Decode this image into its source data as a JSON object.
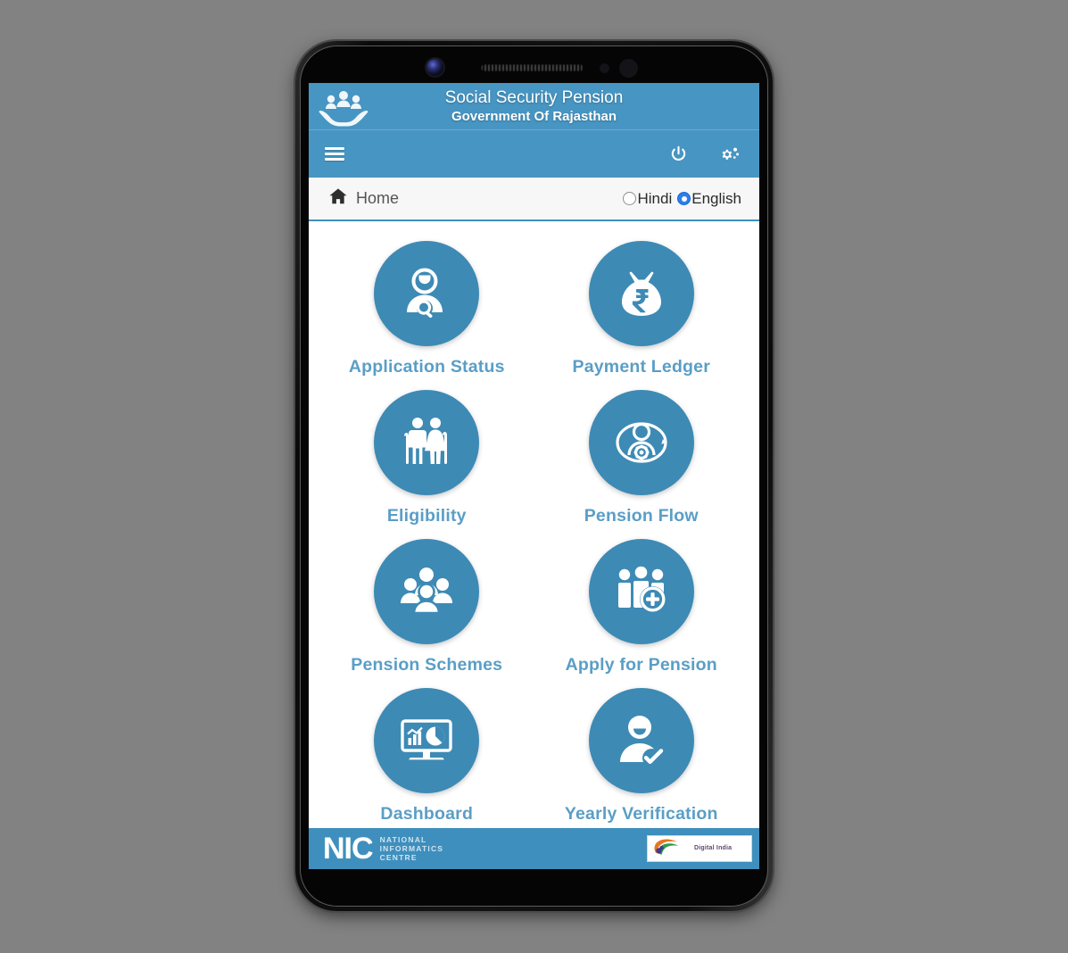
{
  "app": {
    "title": "Social Security Pension",
    "subtitle": "Government Of Rajasthan",
    "logo_icon": "hands-holding-family-logo",
    "accent_color": "#4795c2",
    "tile_circle_color": "#3d8ab5",
    "tile_label_color": "#5a9ec6",
    "footer_color": "#3e8fbd"
  },
  "navbar": {
    "menu_icon": "hamburger-menu-icon",
    "power_icon": "power-icon",
    "settings_icon": "cogs-icon"
  },
  "breadcrumb": {
    "home_icon": "home-icon",
    "home_label": "Home"
  },
  "language": {
    "options": [
      {
        "label": "Hindi",
        "selected": false
      },
      {
        "label": "English",
        "selected": true
      }
    ]
  },
  "tiles": [
    {
      "label": "Application Status",
      "icon": "user-search-icon"
    },
    {
      "label": "Payment Ledger",
      "icon": "money-bag-rupee-icon"
    },
    {
      "label": "Eligibility",
      "icon": "elderly-couple-icon"
    },
    {
      "label": "Pension Flow",
      "icon": "user-gear-cycle-icon"
    },
    {
      "label": "Pension Schemes",
      "icon": "people-group-icon"
    },
    {
      "label": "Apply for Pension",
      "icon": "people-add-icon"
    },
    {
      "label": "Dashboard",
      "icon": "monitor-charts-icon"
    },
    {
      "label": "Yearly Verification",
      "icon": "user-check-icon"
    }
  ],
  "footer": {
    "nic_mark": "NIC",
    "nic_line1": "NATIONAL",
    "nic_line2": "INFORMATICS",
    "nic_line3": "CENTRE",
    "digital_india_icon": "digital-india-swirl-icon",
    "digital_india_text": "Digital India"
  },
  "device": {
    "camera_icon": "front-camera-icon",
    "speaker_icon": "earpiece-speaker-icon",
    "sensor_icon": "proximity-sensor-icon"
  }
}
